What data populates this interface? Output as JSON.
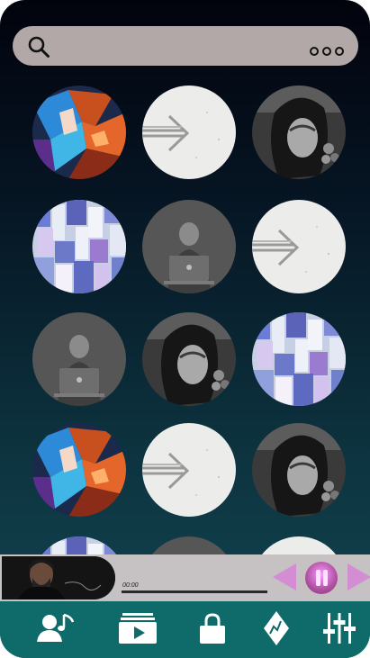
{
  "search": {
    "placeholder": ""
  },
  "grid": {
    "items": [
      {
        "art": "abstract"
      },
      {
        "art": "arrow"
      },
      {
        "art": "portrait-woman"
      },
      {
        "art": "mosaic"
      },
      {
        "art": "laptop-man"
      },
      {
        "art": "arrow"
      },
      {
        "art": "laptop-man"
      },
      {
        "art": "portrait-woman"
      },
      {
        "art": "mosaic"
      },
      {
        "art": "abstract"
      },
      {
        "art": "arrow"
      },
      {
        "art": "portrait-woman"
      },
      {
        "art": "mosaic"
      },
      {
        "art": "laptop-man"
      },
      {
        "art": "arrow"
      }
    ]
  },
  "player": {
    "time": "00:00",
    "progress": 0
  },
  "tabs": [
    {
      "icon": "artist-music-icon"
    },
    {
      "icon": "playlist-play-icon"
    },
    {
      "icon": "lock-icon"
    },
    {
      "icon": "diamond-logo-icon"
    },
    {
      "icon": "equalizer-icon"
    }
  ],
  "colors": {
    "accent": "#0f6b6a",
    "search_bg": "#b3a8a8",
    "player_bg": "#c6c1c2",
    "control_pink": "#d57bd8"
  }
}
